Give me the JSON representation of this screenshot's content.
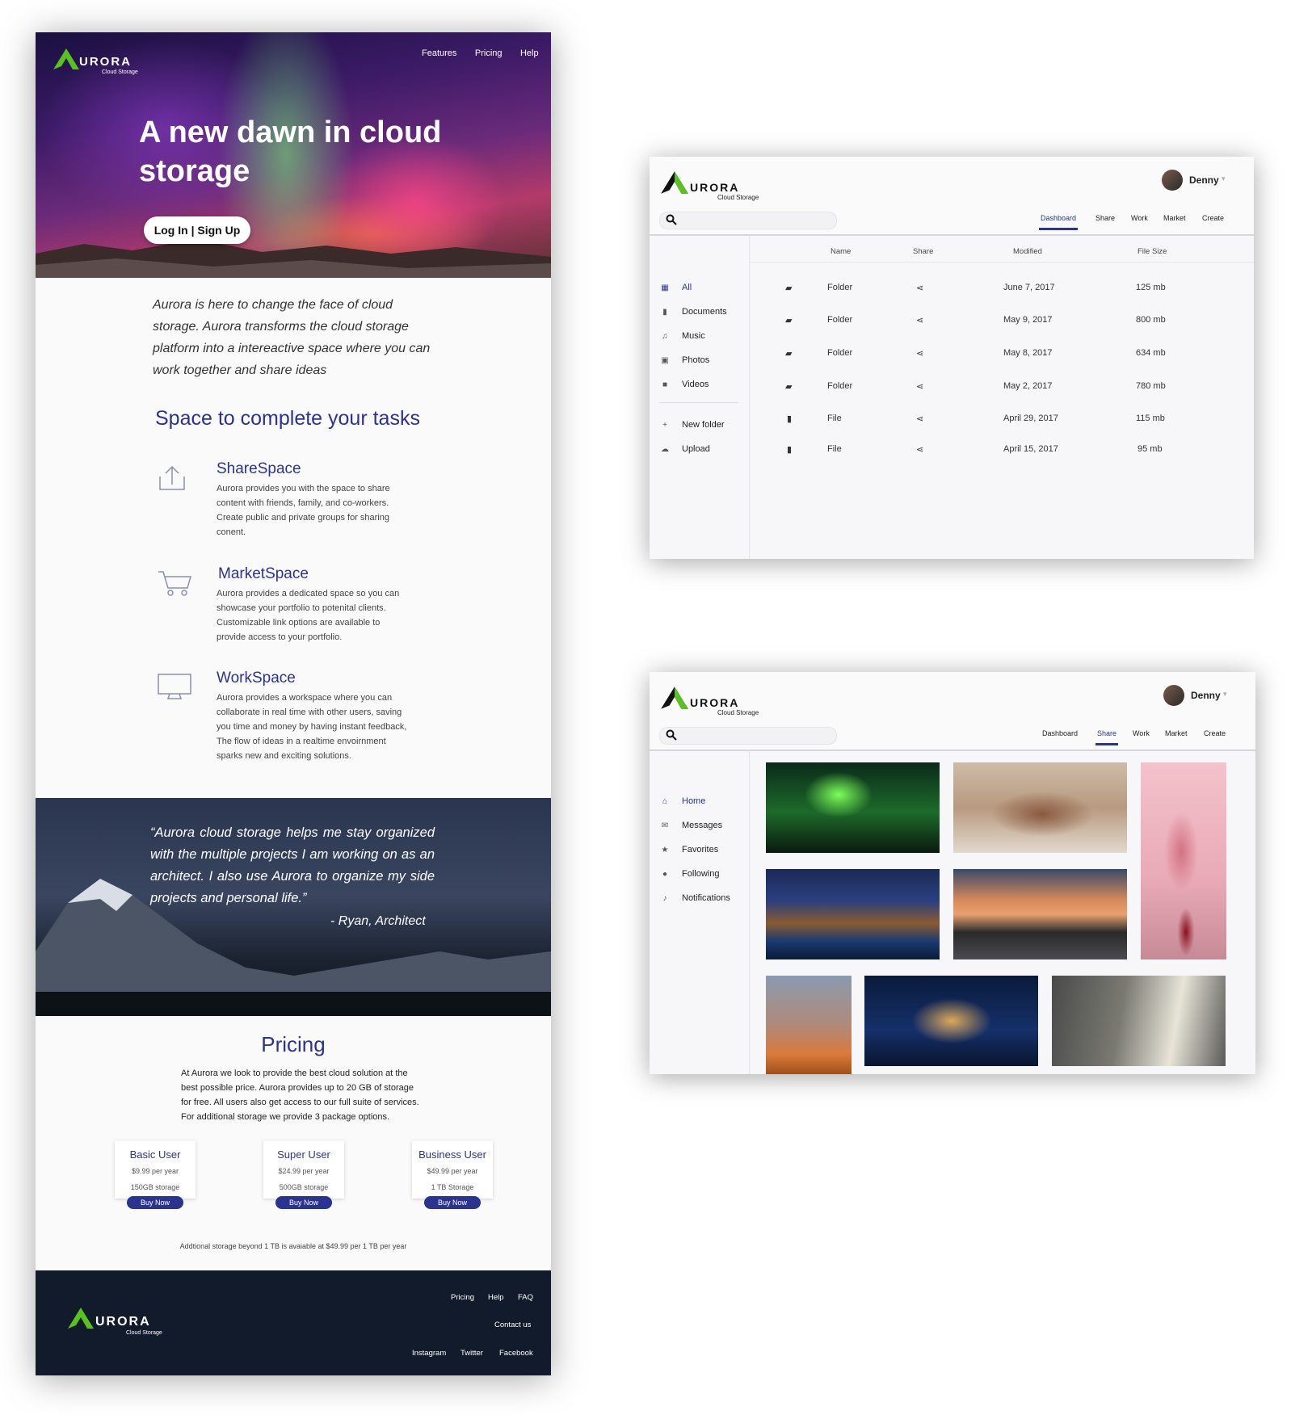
{
  "brand": {
    "logo_text": "URORA",
    "logo_sub": "Cloud Storage",
    "green": "#5ac21d",
    "navy": "#2b3391"
  },
  "landing": {
    "nav": [
      "Features",
      "Pricing",
      "Help"
    ],
    "hero_title": "A new dawn in cloud storage",
    "login_label": "Log In | Sign Up",
    "intro": "Aurora is here to change the face of cloud storage. Aurora transforms the cloud storage platform into a intereactive space where you can work together and share ideas",
    "space_title": "Space to complete your tasks",
    "features": [
      {
        "icon": "upload-icon",
        "title": "ShareSpace",
        "desc": "Aurora provides you with the space to share content with friends, family, and co-workers. Create public and private groups for sharing conent."
      },
      {
        "icon": "cart-icon",
        "title": "MarketSpace",
        "desc": "Aurora provides a dedicated space so you can showcase your portfolio to potenital clients. Customizable link options are available to provide access to your portfolio."
      },
      {
        "icon": "monitor-icon",
        "title": "WorkSpace",
        "desc": "Aurora provides a workspace where you  can collaborate in real time with other users, saving you time and money by having instant feedback, The flow of ideas in a realtime envoirnment sparks new and exciting solutions."
      }
    ],
    "quote": "“Aurora cloud storage helps me stay organized with the multiple projects I am working on as an architect. I also use Aurora to organize my side projects and personal life.”",
    "quote_author": "- Ryan, Architect",
    "pricing_title": "Pricing",
    "pricing_desc": "At Aurora we look to provide the best cloud solution at the best possible price. Aurora provides up to 20 GB of storage for free. All users also get access to our full suite of services. For additional storage we provide 3 package options.",
    "plans": [
      {
        "name": "Basic User",
        "price": "$9.99 per year",
        "storage": "150GB storage",
        "button": "Buy Now"
      },
      {
        "name": "Super User",
        "price": "$24.99 per year",
        "storage": "500GB storage",
        "button": "Buy Now"
      },
      {
        "name": "Business User",
        "price": "$49.99 per year",
        "storage": "1 TB Storage",
        "button": "Buy Now"
      }
    ],
    "pricing_note": "Addtional storage beyond 1 TB is avaiable at $49.99 per 1 TB per year",
    "footer": {
      "links_top": [
        "Pricing",
        "Help",
        "FAQ"
      ],
      "contact": "Contact us",
      "social": [
        "Instagram",
        "Twitter",
        "Facebook"
      ]
    }
  },
  "app": {
    "user": "Denny",
    "tabs": [
      "Dashboard",
      "Share",
      "Work",
      "Market",
      "Create"
    ],
    "dashboard": {
      "sidebar": [
        {
          "icon": "grid-icon",
          "label": "All"
        },
        {
          "icon": "document-icon",
          "label": "Documents"
        },
        {
          "icon": "music-icon",
          "label": "Music"
        },
        {
          "icon": "photo-icon",
          "label": "Photos"
        },
        {
          "icon": "video-icon",
          "label": "Videos"
        }
      ],
      "actions": [
        {
          "icon": "plus-icon",
          "label": "New folder"
        },
        {
          "icon": "cloud-upload-icon",
          "label": "Upload"
        }
      ],
      "columns": [
        "Name",
        "Share",
        "Modified",
        "File Size"
      ],
      "rows": [
        {
          "type": "folder",
          "name": "Folder",
          "modified": "June 7, 2017",
          "size": "125 mb"
        },
        {
          "type": "folder",
          "name": "Folder",
          "modified": "May 9, 2017",
          "size": "800 mb"
        },
        {
          "type": "folder",
          "name": "Folder",
          "modified": "May 8, 2017",
          "size": "634 mb"
        },
        {
          "type": "folder",
          "name": "Folder",
          "modified": "May 2, 2017",
          "size": "780 mb"
        },
        {
          "type": "file",
          "name": "File",
          "modified": "April 29, 2017",
          "size": "115 mb"
        },
        {
          "type": "file",
          "name": "File",
          "modified": "April 15, 2017",
          "size": "95 mb"
        }
      ]
    },
    "share": {
      "sidebar": [
        {
          "icon": "home-icon",
          "label": "Home"
        },
        {
          "icon": "envelope-icon",
          "label": "Messages"
        },
        {
          "icon": "star-icon",
          "label": "Favorites"
        },
        {
          "icon": "users-icon",
          "label": "Following"
        },
        {
          "icon": "bell-icon",
          "label": "Notifications"
        }
      ]
    }
  }
}
